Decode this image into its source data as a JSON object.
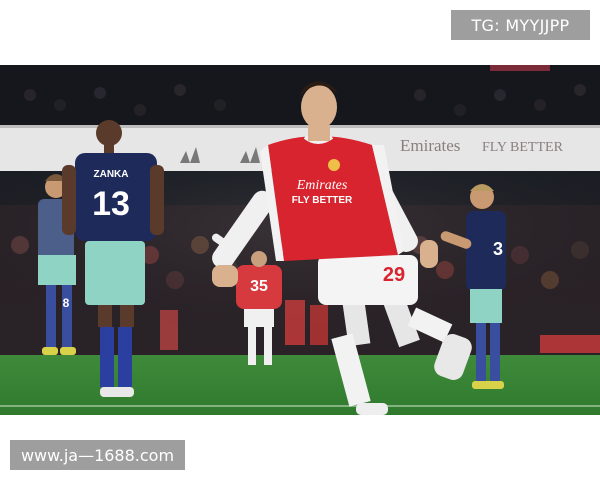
{
  "watermark_top": "TG: MYYJJPP",
  "watermark_bottom": "www.ja—1688.com",
  "photo": {
    "ad_board_brand": "Emirates",
    "ad_board_slogan": "FLY BETTER",
    "main_player": {
      "shirt_sponsor_line1": "Emirates",
      "shirt_sponsor_line2": "FLY BETTER",
      "number": "29"
    },
    "opponent_left": {
      "name": "ZANKA",
      "number": "13"
    },
    "opponent_far_left": {
      "number": "8"
    },
    "teammate_background": {
      "number": "35"
    },
    "opponent_right": {
      "number": "3"
    }
  }
}
